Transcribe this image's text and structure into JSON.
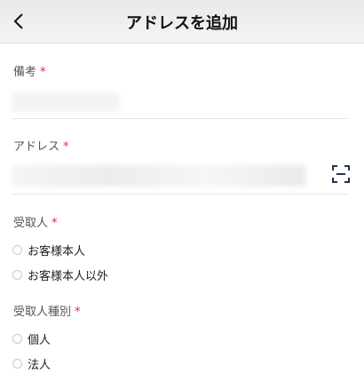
{
  "header": {
    "title": "アドレスを追加"
  },
  "form": {
    "memo": {
      "label": "備考",
      "required_mark": "*"
    },
    "address": {
      "label": "アドレス",
      "required_mark": "*"
    },
    "recipient": {
      "label": "受取人",
      "required_mark": "*",
      "options": [
        "お客様本人",
        "お客様本人以外"
      ]
    },
    "recipient_type": {
      "label": "受取人種別",
      "required_mark": "*",
      "options": [
        "個人",
        "法人"
      ]
    }
  },
  "icons": {
    "back": "chevron-left-icon",
    "scan": "qr-scan-icon"
  },
  "colors": {
    "required": "#e0283a",
    "header_bg": "#efefef"
  }
}
